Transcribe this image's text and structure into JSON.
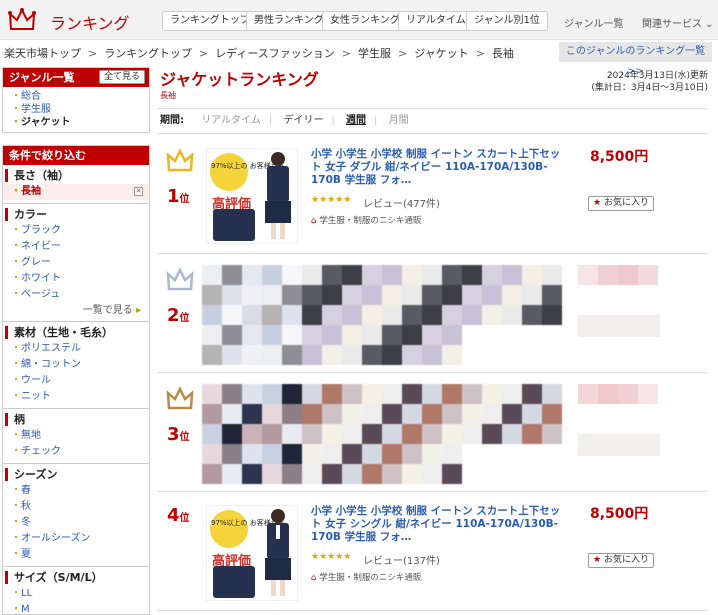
{
  "header": {
    "logo_text": "ランキング",
    "nav": [
      "ランキングトップ",
      "男性ランキング",
      "女性ランキング",
      "リアルタイム",
      "ジャンル別1位"
    ],
    "links": [
      "ジャンル一覧",
      "関連サービス ⌄"
    ]
  },
  "breadcrumb": [
    "楽天市場トップ",
    "ランキングトップ",
    "レディースファッション",
    "学生服",
    "ジャケット",
    "長袖"
  ],
  "genre_list_button": "このジャンルのランキング一覧 >>",
  "sidebar": {
    "genre_title": "ジャンル一覧",
    "all_button": "全て見る",
    "genres": [
      "総合",
      "学生服",
      "ジャケット"
    ],
    "filter_title": "条件で絞り込む",
    "groups": [
      {
        "title": "長さ（袖）",
        "items": [
          "長袖"
        ]
      },
      {
        "title": "カラー",
        "items": [
          "ブラック",
          "ネイビー",
          "グレー",
          "ホワイト",
          "ベージュ"
        ],
        "more": "一覧で見る"
      },
      {
        "title": "素材（生地・毛糸）",
        "items": [
          "ポリエステル",
          "綿・コットン",
          "ウール",
          "ニット"
        ]
      },
      {
        "title": "柄",
        "items": [
          "無地",
          "チェック"
        ]
      },
      {
        "title": "シーズン",
        "items": [
          "春",
          "秋",
          "冬",
          "オールシーズン",
          "夏"
        ]
      },
      {
        "title": "サイズ（S/M/L）",
        "items": [
          "LL",
          "M"
        ]
      }
    ]
  },
  "main": {
    "title": "ジャケットランキング",
    "subtitle": "長袖",
    "updated": "2024年3月13日(水)更新",
    "period_range": "(集計日：3月4日〜3月10日)",
    "period_label": "期間:",
    "periods": [
      "リアルタイム",
      "デイリー",
      "週間",
      "月間"
    ],
    "active_period": "週間"
  },
  "rankings": [
    {
      "rank": "1",
      "rank_suffix": "位",
      "title": "小学 小学生 小学校 制服 イートン スカート上下セット 女子 ダブル 紺/ネイビー 110A-170A/130B-170B 学生服 フォ…",
      "stars": "★★★★★",
      "review": "レビュー(477件)",
      "shop": "学生服・制服のニシキ通販",
      "price": "8,500円",
      "fav": "お気に入り",
      "badge_top": "97%以上の お客様から",
      "badge_main": "高評価",
      "crown_color": "#e8b820"
    },
    {
      "rank": "2",
      "rank_suffix": "位",
      "crown_color": "#a9b8cc"
    },
    {
      "rank": "3",
      "rank_suffix": "位",
      "crown_color": "#b98a4a"
    },
    {
      "rank": "4",
      "rank_suffix": "位",
      "title": "小学 小学生 小学校 制服 イートン スカート上下セット 女子 シングル 紺/ネイビー 110A-170A/130B-170B 学生服 フォ…",
      "stars": "★★★★★",
      "review": "レビュー(137件)",
      "shop": "学生服・制服のニシキ通販",
      "price": "8,500円",
      "fav": "お気に入り",
      "badge_top": "97%以上の お客様から",
      "badge_main": "高評価",
      "crown_color": "#bf0000"
    }
  ]
}
